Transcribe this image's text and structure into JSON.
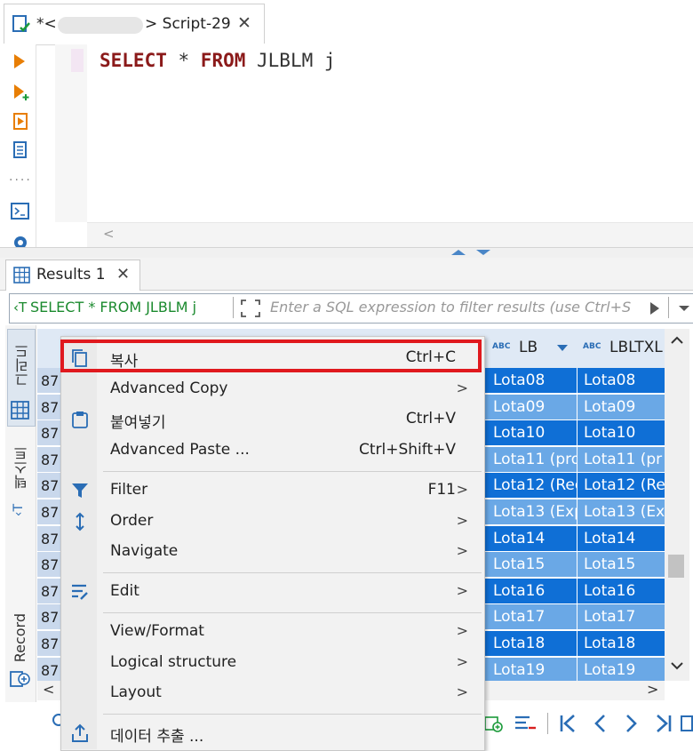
{
  "editor_tab": {
    "title_prefix": "*<",
    "title_suffix": "> Script-29",
    "close": "✕"
  },
  "editor": {
    "sql_kw1": "SELECT",
    "sql_mid": " * ",
    "sql_kw2": "FROM",
    "sql_rest": " JLBLM j",
    "scroll_left": "<"
  },
  "results_tab": {
    "label": "Results 1",
    "close": "✕"
  },
  "filter": {
    "sql": "SELECT * FROM JLBLM j",
    "placeholder": "Enter a SQL expression to filter results (use Ctrl+S"
  },
  "side_panel": {
    "grid": "그리드",
    "text": "텍스트",
    "record": "Record"
  },
  "grid": {
    "col_lb": "LB",
    "col_lbltxl": "LBLTXL",
    "col_type_badge": "ABC",
    "row_number_prefix": "87",
    "rows": [
      {
        "lb": "Lota08",
        "lbltxl": "Lota08"
      },
      {
        "lb": "Lota09",
        "lbltxl": "Lota09"
      },
      {
        "lb": "Lota10",
        "lbltxl": "Lota10"
      },
      {
        "lb": "Lota11 (pro",
        "lbltxl": "Lota11 (pr"
      },
      {
        "lb": "Lota12 (Rec",
        "lbltxl": "Lota12 (Re"
      },
      {
        "lb": "Lota13 (Exp",
        "lbltxl": "Lota13 (Ex"
      },
      {
        "lb": "Lota14",
        "lbltxl": "Lota14"
      },
      {
        "lb": "Lota15",
        "lbltxl": "Lota15"
      },
      {
        "lb": "Lota16",
        "lbltxl": "Lota16"
      },
      {
        "lb": "Lota17",
        "lbltxl": "Lota17"
      },
      {
        "lb": "Lota18",
        "lbltxl": "Lota18"
      },
      {
        "lb": "Lota19",
        "lbltxl": "Lota19"
      }
    ],
    "scroll_left": "<",
    "scroll_right": ">"
  },
  "context_menu": {
    "copy": {
      "label": "복사",
      "shortcut": "Ctrl+C"
    },
    "advanced_copy": {
      "label": "Advanced Copy"
    },
    "paste": {
      "label": "붙여넣기",
      "shortcut": "Ctrl+V"
    },
    "advanced_paste": {
      "label": "Advanced Paste ...",
      "shortcut": "Ctrl+Shift+V"
    },
    "filter": {
      "label": "Filter",
      "shortcut": "F11"
    },
    "order": {
      "label": "Order"
    },
    "navigate": {
      "label": "Navigate"
    },
    "edit": {
      "label": "Edit"
    },
    "view_format": {
      "label": "View/Format"
    },
    "logical_structure": {
      "label": "Logical structure"
    },
    "layout": {
      "label": "Layout"
    },
    "export": {
      "label": "데이터 추출 ..."
    },
    "submenu_arrow": ">"
  },
  "colors": {
    "row_dark": "#0f6fd6",
    "row_light": "#6aa8e6",
    "highlight_border": "#e0191e",
    "icon_blue": "#2a6db5",
    "icon_orange": "#e87e04"
  }
}
